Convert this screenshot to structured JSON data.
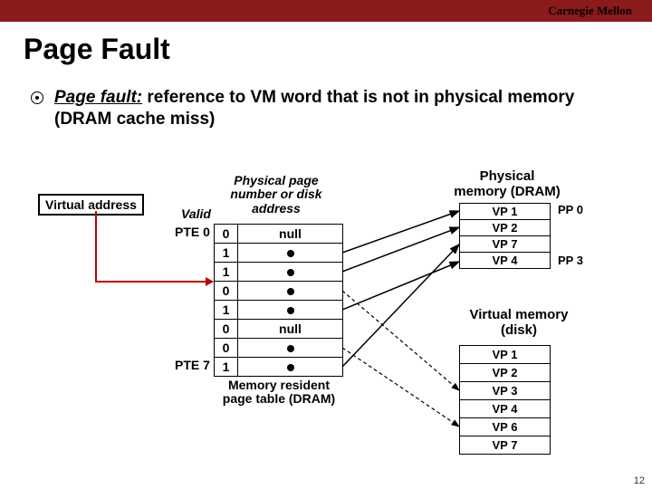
{
  "header": {
    "institution": "Carnegie Mellon"
  },
  "title": "Page Fault",
  "bullet": {
    "term": "Page fault:",
    "rest": " reference to VM word that is not in physical memory (DRAM cache miss)"
  },
  "virtual_address_label": "Virtual address",
  "columns": {
    "valid": "Valid",
    "ppn": "Physical page number or disk address"
  },
  "row_labels": {
    "first": "PTE 0",
    "last": "PTE 7"
  },
  "page_table": [
    {
      "valid": "0",
      "addr": "null"
    },
    {
      "valid": "1",
      "addr": ""
    },
    {
      "valid": "1",
      "addr": ""
    },
    {
      "valid": "0",
      "addr": ""
    },
    {
      "valid": "1",
      "addr": ""
    },
    {
      "valid": "0",
      "addr": "null"
    },
    {
      "valid": "0",
      "addr": ""
    },
    {
      "valid": "1",
      "addr": ""
    }
  ],
  "caption_mrt": "Memory resident page table (DRAM)",
  "physical_memory": {
    "title": "Physical memory (DRAM)",
    "frames": [
      "VP 1",
      "VP 2",
      "VP 7",
      "VP 4"
    ],
    "frame_labels": [
      "PP 0",
      "PP 3"
    ]
  },
  "virtual_memory": {
    "title": "Virtual memory (disk)",
    "pages": [
      "VP 1",
      "VP 2",
      "VP 3",
      "VP 4",
      "VP 6",
      "VP 7"
    ]
  },
  "page_number": "12"
}
